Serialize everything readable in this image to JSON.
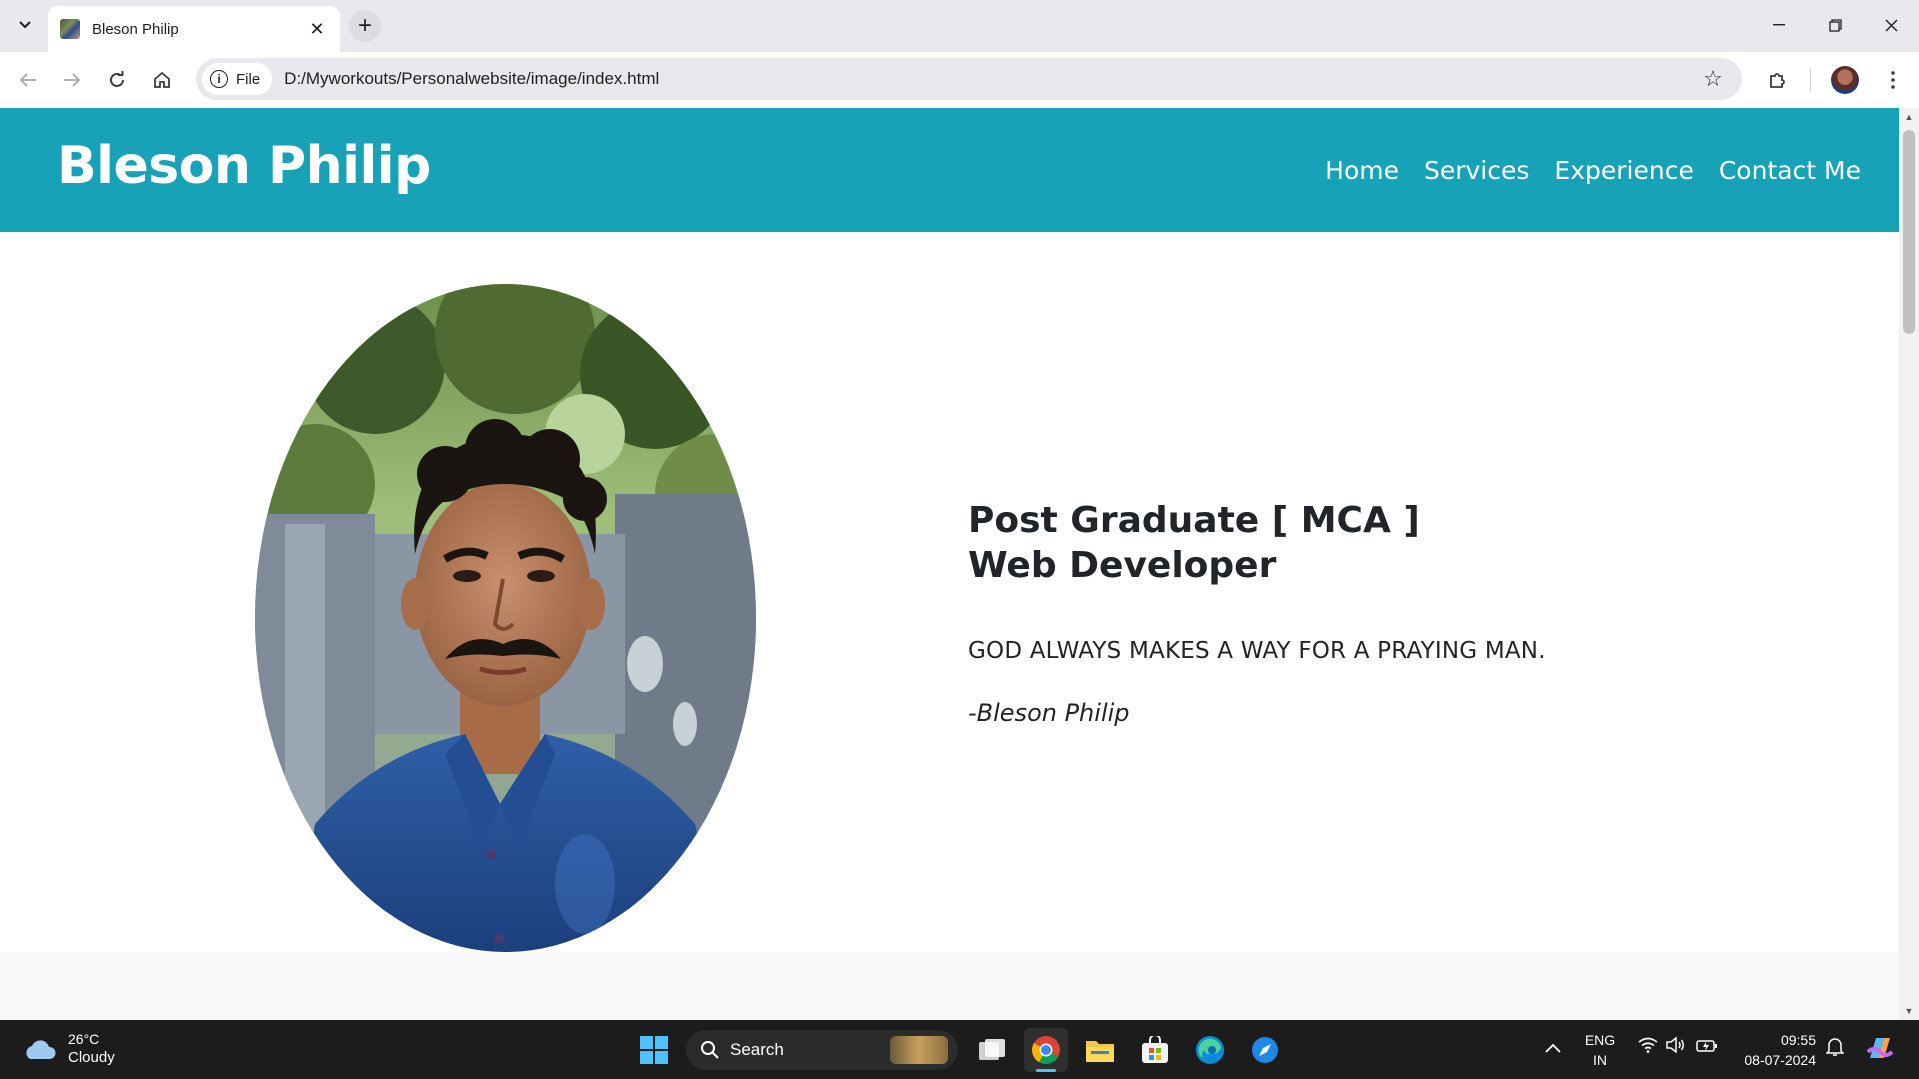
{
  "browser": {
    "tab": {
      "title": "Bleson Philip"
    },
    "address": {
      "chip_label": "File",
      "url": "D:/Myworkouts/Personalwebsite/image/index.html"
    }
  },
  "site": {
    "brand": "Bleson Philip",
    "nav": [
      "Home",
      "Services",
      "Experience",
      "Contact Me"
    ],
    "hero": {
      "line1": "Post Graduate [ MCA ]",
      "line2": "Web Developer",
      "quote": "GOD ALWAYS MAKES A WAY FOR A PRAYING MAN.",
      "author": "-Bleson Philip"
    },
    "colors": {
      "header_bg": "#17a2b8",
      "text": "#212529"
    }
  },
  "taskbar": {
    "weather": {
      "temp": "26°C",
      "condition": "Cloudy"
    },
    "search_placeholder": "Search",
    "language": {
      "lang": "ENG",
      "region": "IN"
    },
    "clock": {
      "time": "09:55",
      "date": "08-07-2024"
    }
  }
}
